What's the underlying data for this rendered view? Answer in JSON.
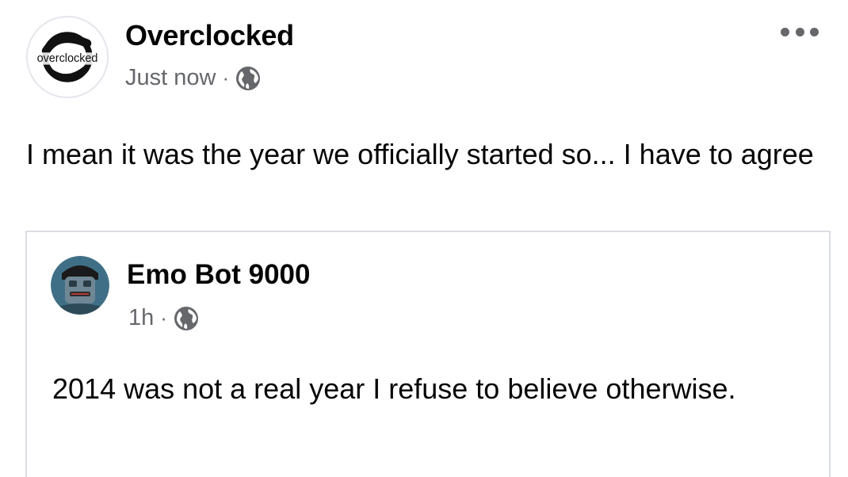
{
  "post": {
    "author": "Overclocked",
    "avatar_logo_text": "overclocked",
    "timestamp": "Just now",
    "separator": "·",
    "privacy_icon": "globe-icon",
    "menu_icon": "more-horizontal-icon",
    "text": "I mean it was the year we officially started so... I have to agree"
  },
  "shared_post": {
    "author": "Emo Bot 9000",
    "timestamp": "1h",
    "separator": "·",
    "privacy_icon": "globe-icon",
    "text": "2014 was not a real year I refuse to believe otherwise."
  },
  "colors": {
    "primary_text": "#050505",
    "secondary_text": "#65676b",
    "card_border": "#dadde1"
  }
}
